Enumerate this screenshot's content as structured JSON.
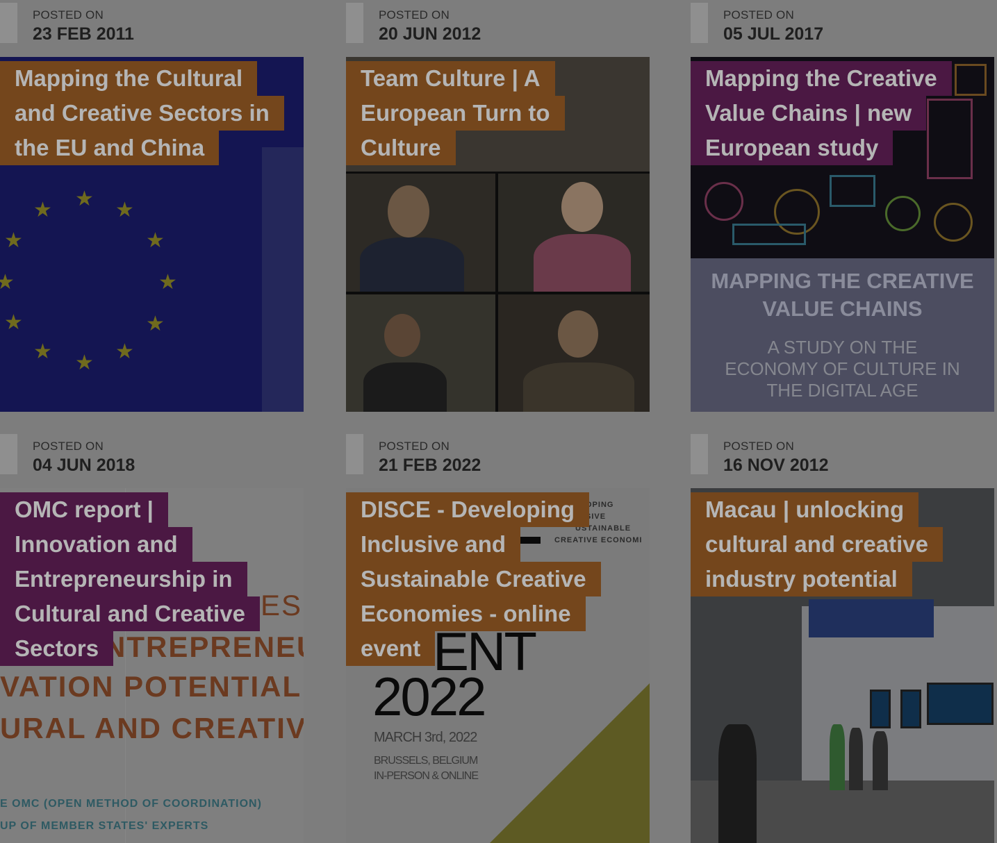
{
  "posts": [
    {
      "posted_label": "POSTED ON",
      "date": "23 FEB 2011",
      "title_lines": [
        "Mapping the Cultural",
        "and Creative Sectors in",
        "the EU and China"
      ],
      "title_color": "#74461c",
      "thumbnail": "eu-flag-image"
    },
    {
      "posted_label": "POSTED ON",
      "date": "20 JUN 2012",
      "title_lines": [
        "Team Culture | A",
        "European Turn to",
        "Culture"
      ],
      "title_color": "#74461c",
      "thumbnail": "speakers-grid-image"
    },
    {
      "posted_label": "POSTED ON",
      "date": "05 JUL 2017",
      "title_lines": [
        "Mapping the Creative",
        "Value Chains | new",
        "European study"
      ],
      "title_color": "#4b1843",
      "thumbnail": "circuit-art-image",
      "image_text": {
        "heading_1": "MAPPING THE CREATIVE",
        "heading_2": "VALUE CHAINS",
        "sub_1": "A STUDY ON THE",
        "sub_2": "ECONOMY OF CULTURE IN",
        "sub_3": "THE DIGITAL AGE"
      }
    },
    {
      "posted_label": "POSTED ON",
      "date": "04 JUN 2018",
      "title_lines": [
        "OMC report |",
        "Innovation and",
        "Entrepreneurship in",
        "Cultural and Creative",
        "Sectors"
      ],
      "title_color": "#4b1843",
      "thumbnail": "omc-report-cover",
      "image_text": {
        "l1": "ES",
        "l2": "NTREPRENEU",
        "l3": "VATION POTENTIAL",
        "l4": "URAL AND CREATIVE",
        "l5": "E OMC (OPEN METHOD OF COORDINATION)",
        "l6": "UP OF MEMBER STATES' EXPERTS"
      }
    },
    {
      "posted_label": "POSTED ON",
      "date": "21 FEB 2022",
      "title_lines": [
        "DISCE - Developing",
        "Inclusive and",
        "Sustainable Creative",
        "Economies - online",
        "event"
      ],
      "title_color": "#74461c",
      "thumbnail": "disce-event-poster",
      "image_text": {
        "top_1": "OPING",
        "top_2": "SIVE",
        "top_3": "USTAINABLE",
        "top_4": "CREATIVE ECONOMI",
        "ent": "ENT",
        "year": "2022",
        "date": "MARCH 3rd, 2022",
        "place_1": "BRUSSELS, BELGIUM",
        "place_2": "IN-PERSON & ONLINE"
      }
    },
    {
      "posted_label": "POSTED ON",
      "date": "16 NOV 2012",
      "title_lines": [
        "Macau | unlocking",
        "cultural and creative",
        "industry potential"
      ],
      "title_color": "#74461c",
      "thumbnail": "macau-expo-photo"
    }
  ]
}
